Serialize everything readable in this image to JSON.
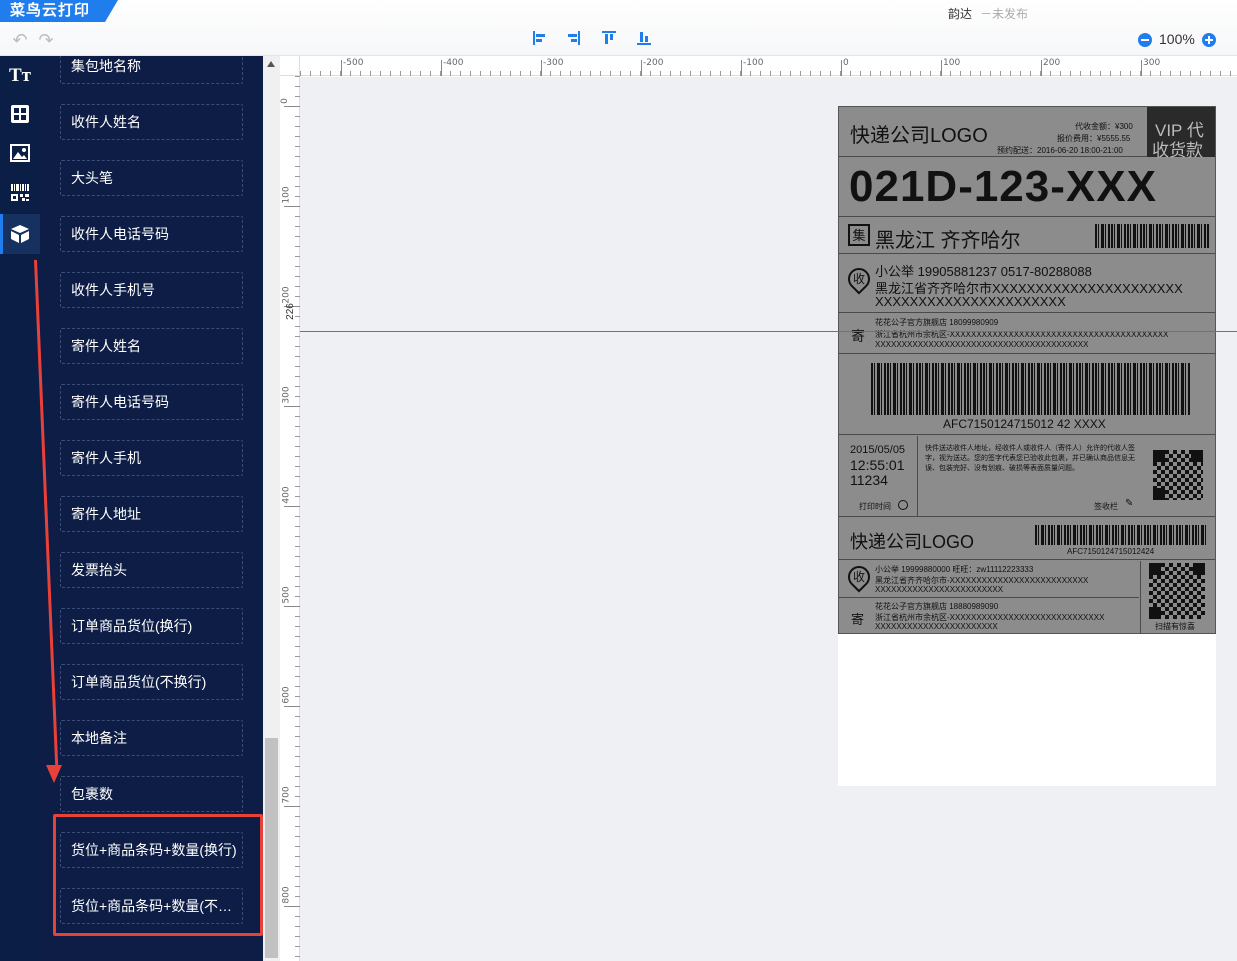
{
  "brand": "菜鸟云打印",
  "header": {
    "template_name": "韵达",
    "template_status": "－未发布",
    "zoom_level": "100%"
  },
  "rail": {
    "items": [
      {
        "icon": "text-icon",
        "active": false
      },
      {
        "icon": "layout-grid-icon",
        "active": false
      },
      {
        "icon": "image-icon",
        "active": false
      },
      {
        "icon": "barcode-qrcode-icon",
        "active": false
      },
      {
        "icon": "package-box-icon",
        "active": true
      }
    ]
  },
  "fields": [
    "集包地名称",
    "收件人姓名",
    "大头笔",
    "收件人电话号码",
    "收件人手机号",
    "寄件人姓名",
    "寄件人电话号码",
    "寄件人手机",
    "寄件人地址",
    "发票抬头",
    "订单商品货位(换行)",
    "订单商品货位(不换行)",
    "本地备注",
    "包裹数",
    "货位+商品条码+数量(换行)",
    "货位+商品条码+数量(不换行)"
  ],
  "ruler": {
    "h_labels": [
      "-500",
      "-400",
      "-300",
      "-200",
      "-100",
      "0",
      "100",
      "200",
      "300"
    ],
    "v_labels": [
      "0",
      "100",
      "200",
      "300",
      "400",
      "500",
      "600",
      "700",
      "800"
    ],
    "guide_value": "226"
  },
  "label": {
    "logo": "快递公司LOGO",
    "cod_amount": "代收金额：¥300",
    "insurance_fee": "报价费用：¥5555.55",
    "scheduled": "预约配送：2016-06-20 18:00-21:00",
    "vip": "VIP 代",
    "vip_line2": "收货款",
    "sort_code": "021D-123-XXX",
    "dest_badge": "集",
    "destination": "黑龙江  齐齐哈尔",
    "recv_badge": "收",
    "recv_name_phone": "小公举    19905881237    0517-80288088",
    "recv_addr": "黑龙江省齐齐哈尔市XXXXXXXXXXXXXXXXXXXXXX",
    "recv_addr2": "XXXXXXXXXXXXXXXXXXXXXX",
    "send_badge": "寄",
    "send_name_phone": "花花公子官方旗舰店    18099980909",
    "send_addr": "浙江省杭州市余杭区-XXXXXXXXXXXXXXXXXXXXXXXXXXXXXXXXXXXXXXXXX",
    "send_addr2": "XXXXXXXXXXXXXXXXXXXXXXXXXXXXXXXXXXXXXXXX",
    "waybill_no": "AFC7150124715012 42 XXXX",
    "print_date": "2015/05/05",
    "print_time": "12:55:01",
    "print_extra": "11234",
    "print_time_label": "打印时间",
    "terms": "快件送达收件人地址，经收件人或收件人（寄件人）允许的代收人签字，视为送达。您的签字代表您已验收此包裹，并已确认商品信息无误、包装完好、没有划痕、破损等表面质量问题。",
    "sign_label": "签收栏",
    "logo2": "快递公司LOGO",
    "waybill_no2": "AFC7150124715012424",
    "recv2_name_phone": "小公举    19999880000    旺旺：zw11112223333",
    "recv2_addr": "黑龙江省齐齐哈尔市-XXXXXXXXXXXXXXXXXXXXXXXXXX",
    "recv2_addr2": "XXXXXXXXXXXXXXXXXXXXXXXX",
    "send2_name_phone": "花花公子官方旗舰店    18880989090",
    "send2_addr": "浙江省杭州市余杭区-XXXXXXXXXXXXXXXXXXXXXXXXXXXXX",
    "send2_addr2": "XXXXXXXXXXXXXXXXXXXXXXX",
    "qr_caption": "扫描有惊喜"
  },
  "colors": {
    "accent": "#1f7ded",
    "panel_bg": "#0d1d45",
    "highlight": "#e8413a"
  }
}
